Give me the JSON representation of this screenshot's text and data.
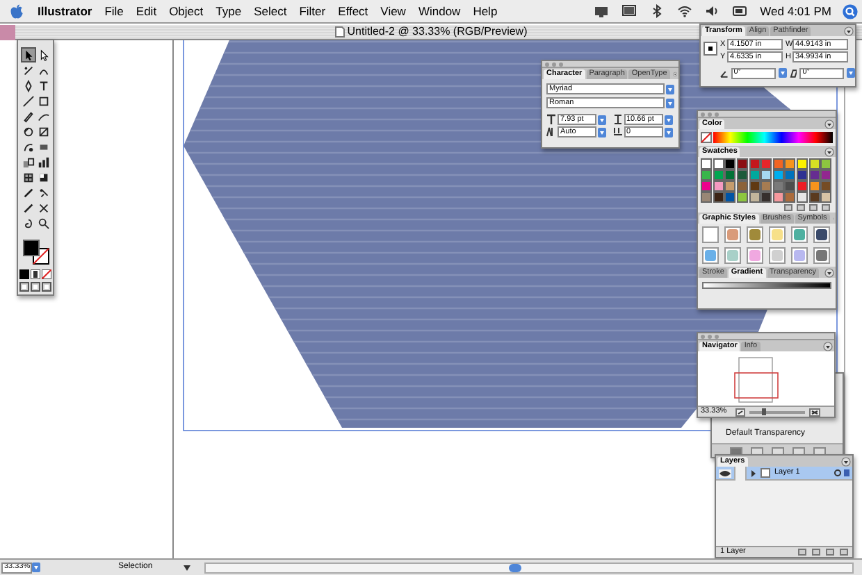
{
  "menu_bar": {
    "app": "Illustrator",
    "menus": [
      "File",
      "Edit",
      "Object",
      "Type",
      "Select",
      "Filter",
      "Effect",
      "View",
      "Window",
      "Help"
    ],
    "clock": "Wed 4:01 PM"
  },
  "document": {
    "title": "Untitled-2 @ 33.33% (RGB/Preview)",
    "zoom": "33.33%",
    "status": "Selection"
  },
  "toolbox": {
    "tools": [
      {
        "selected": true
      },
      {
        "selected": false
      },
      {
        "selected": false
      },
      {
        "selected": false
      },
      {
        "selected": false
      },
      {
        "selected": false
      },
      {
        "selected": false
      },
      {
        "selected": false
      },
      {
        "selected": false
      },
      {
        "selected": false
      },
      {
        "selected": false
      },
      {
        "selected": false
      },
      {
        "selected": false
      },
      {
        "selected": false
      },
      {
        "selected": false
      },
      {
        "selected": false
      },
      {
        "selected": false
      },
      {
        "selected": false
      },
      {
        "selected": false
      },
      {
        "selected": false
      },
      {
        "selected": false
      },
      {
        "selected": false
      },
      {
        "selected": false
      },
      {
        "selected": false
      }
    ]
  },
  "transform": {
    "tabs": [
      {
        "label": "Transform",
        "selected": true
      },
      {
        "label": "Align",
        "selected": false
      },
      {
        "label": "Pathfinder",
        "selected": false
      }
    ],
    "fields": [
      {
        "label": "X",
        "value": "4.1507 in"
      },
      {
        "label": "W",
        "value": "44.9143 in"
      },
      {
        "label": "Y",
        "value": "4.6335 in"
      },
      {
        "label": "H",
        "value": "34.9934 in"
      }
    ],
    "angles": [
      "0°",
      "0°"
    ]
  },
  "character": {
    "tabs": [
      {
        "label": "Character",
        "selected": true
      },
      {
        "label": "Paragraph",
        "selected": false
      },
      {
        "label": "OpenType",
        "selected": false
      }
    ],
    "font": "Myriad",
    "style": "Roman",
    "fields": [
      "7.93 pt",
      "10.66 pt",
      "Auto",
      "0"
    ]
  },
  "color": {
    "tabs": [
      {
        "label": "Color",
        "selected": true
      }
    ]
  },
  "swatches": {
    "tabs": [
      {
        "label": "Swatches",
        "selected": true
      }
    ],
    "items": [
      {
        "color": "#ffffff"
      },
      {
        "color": "#ffffff"
      },
      {
        "color": "#000000"
      },
      {
        "color": "#8b0f12"
      },
      {
        "color": "#c4161c"
      },
      {
        "color": "#e8262a"
      },
      {
        "color": "#f26522"
      },
      {
        "color": "#f7941d"
      },
      {
        "color": "#fff200"
      },
      {
        "color": "#d7df23"
      },
      {
        "color": "#8dc63f"
      },
      {
        "color": "#39b54a"
      },
      {
        "color": "#00a651"
      },
      {
        "color": "#007236"
      },
      {
        "color": "#1d5a3a"
      },
      {
        "color": "#00a99d"
      },
      {
        "color": "#a6d8f0"
      },
      {
        "color": "#00aeef"
      },
      {
        "color": "#0072bc"
      },
      {
        "color": "#2e3192"
      },
      {
        "color": "#662d91"
      },
      {
        "color": "#92278f"
      },
      {
        "color": "#ec008c"
      },
      {
        "color": "#f49ac1"
      },
      {
        "color": "#c69c6d"
      },
      {
        "color": "#8c6239"
      },
      {
        "color": "#603913"
      },
      {
        "color": "#a67c52"
      },
      {
        "color": "#7a7a7a"
      },
      {
        "color": "#4d4d4d"
      },
      {
        "color": "#ed1c24"
      },
      {
        "color": "#f7941d"
      },
      {
        "color": "#754c24"
      },
      {
        "color": "#998675"
      },
      {
        "color": "#3c2415"
      },
      {
        "color": "#0054a6"
      },
      {
        "color": "#8dc63f"
      },
      {
        "color": "#c2b59b"
      },
      {
        "color": "#362f2d"
      },
      {
        "color": "#f5989d"
      },
      {
        "color": "#ab6b3c"
      },
      {
        "color": "#e6e6e6"
      },
      {
        "color": "#5a3a1e"
      },
      {
        "color": "#d8c3a5"
      }
    ]
  },
  "graphic_styles": {
    "tabs": [
      {
        "label": "Graphic Styles",
        "selected": true
      },
      {
        "label": "Brushes",
        "selected": false
      },
      {
        "label": "Symbols",
        "selected": false
      }
    ]
  },
  "gradient": {
    "tabs": [
      {
        "label": "Stroke",
        "selected": false
      },
      {
        "label": "Gradient",
        "selected": true
      },
      {
        "label": "Transparency",
        "selected": false
      }
    ]
  },
  "navigator": {
    "tabs": [
      {
        "label": "Navigator",
        "selected": true
      },
      {
        "label": "Info",
        "selected": false
      }
    ],
    "zoom": "33.33%",
    "slider": {
      "level": 0.25
    }
  },
  "transparency": {
    "label": "Default Transparency"
  },
  "layers": {
    "tabs": [
      {
        "label": "Layers",
        "selected": true
      }
    ],
    "items": [
      {
        "name": "Layer 1",
        "visible": true,
        "selected": true
      }
    ],
    "count": "1 Layer"
  }
}
